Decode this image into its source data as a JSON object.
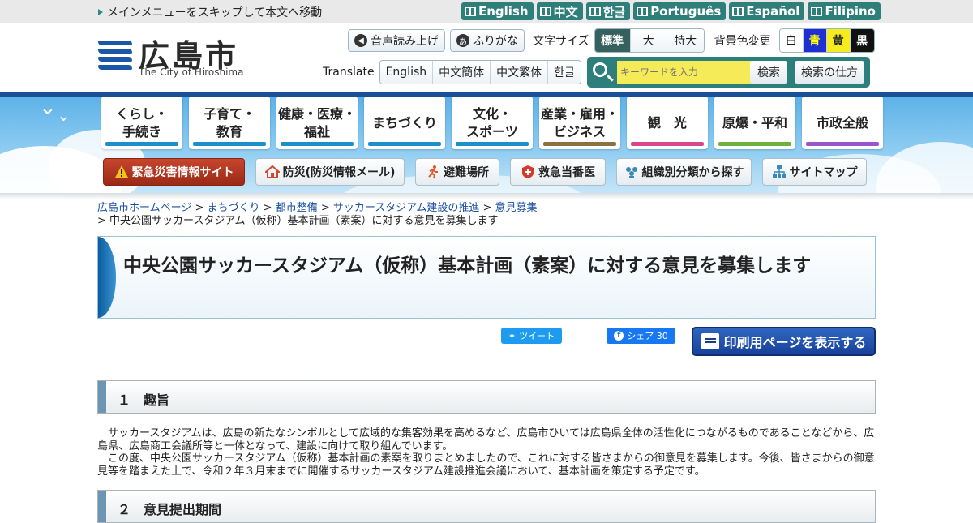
{
  "skip_link": "メインメニューをスキップして本文へ移動",
  "languages": [
    "English",
    "中文",
    "한글",
    "Português",
    "Español",
    "Filipino"
  ],
  "site": {
    "name": "広島市",
    "name_en": "The City of Hiroshima"
  },
  "tools": {
    "speech": "音声読み上げ",
    "furigana": "ふりがな",
    "furigana_icon": "あ",
    "font_size_label": "文字サイズ",
    "font_sizes": [
      "標準",
      "大",
      "特大"
    ],
    "bg_label": "背景色変更",
    "bg_colors": [
      "白",
      "青",
      "黄",
      "黒"
    ],
    "translate_label": "Translate",
    "translate_options": [
      "English",
      "中文簡体",
      "中文繁体",
      "한글"
    ]
  },
  "search": {
    "placeholder": "キーワードを入力",
    "button": "検索",
    "howto": "検索の仕方"
  },
  "global_nav": [
    {
      "label": "くらし・\n手続き",
      "color": "#1c8fc9"
    },
    {
      "label": "子育て・\n教育",
      "color": "#1c8fc9"
    },
    {
      "label": "健康・医療・\n福祉",
      "color": "#1c8fc9"
    },
    {
      "label": "まちづくり",
      "color": "#1c8fc9"
    },
    {
      "label": "文化・\nスポーツ",
      "color": "#1c8fc9"
    },
    {
      "label": "産業・雇用・\nビジネス",
      "color": "#8a7240"
    },
    {
      "label": "観　光",
      "color": "#d9478a"
    },
    {
      "label": "原爆・平和",
      "color": "#6bb33b"
    },
    {
      "label": "市政全般",
      "color": "#9a55c9"
    }
  ],
  "quick_nav": [
    {
      "label": "緊急災害情報サイト",
      "icon": "warning-icon"
    },
    {
      "label": "防災(防災情報メール)",
      "icon": "house-icon"
    },
    {
      "label": "避難場所",
      "icon": "running-person-icon"
    },
    {
      "label": "救急当番医",
      "icon": "medical-cross-icon"
    },
    {
      "label": "組織別分類から探す",
      "icon": "people-icon"
    },
    {
      "label": "サイトマップ",
      "icon": "sitemap-icon"
    }
  ],
  "breadcrumb": {
    "links": [
      "広島市ホームページ",
      "まちづくり",
      "都市整備",
      "サッカースタジアム建設の推進",
      "意見募集"
    ],
    "current": "中央公園サッカースタジアム（仮称）基本計画（素案）に対する意見を募集します"
  },
  "page_title": "中央公園サッカースタジアム（仮称）基本計画（素案）に対する意見を募集します",
  "social": {
    "tweet": "ツイート",
    "share": "シェア 30"
  },
  "print_button": "印刷用ページを表示する",
  "sections": [
    {
      "heading": "１　趣旨",
      "paragraphs": [
        "　サッカースタジアムは、広島の新たなシンボルとして広域的な集客効果を高めるなど、広島市ひいては広島県全体の活性化につながるものであることなどから、広島県、広島商工会議所等と一体となって、建設に向けて取り組んでいます。",
        "　この度、中央公園サッカースタジアム（仮称）基本計画の素案を取りまとめましたので、これに対する皆さまからの御意見を募集します。今後、皆さまからの御意見等を踏まえた上で、令和２年３月末までに開催するサッカースタジアム建設推進会議において、基本計画を策定する予定です。"
      ]
    },
    {
      "heading": "２　意見提出期間"
    }
  ]
}
